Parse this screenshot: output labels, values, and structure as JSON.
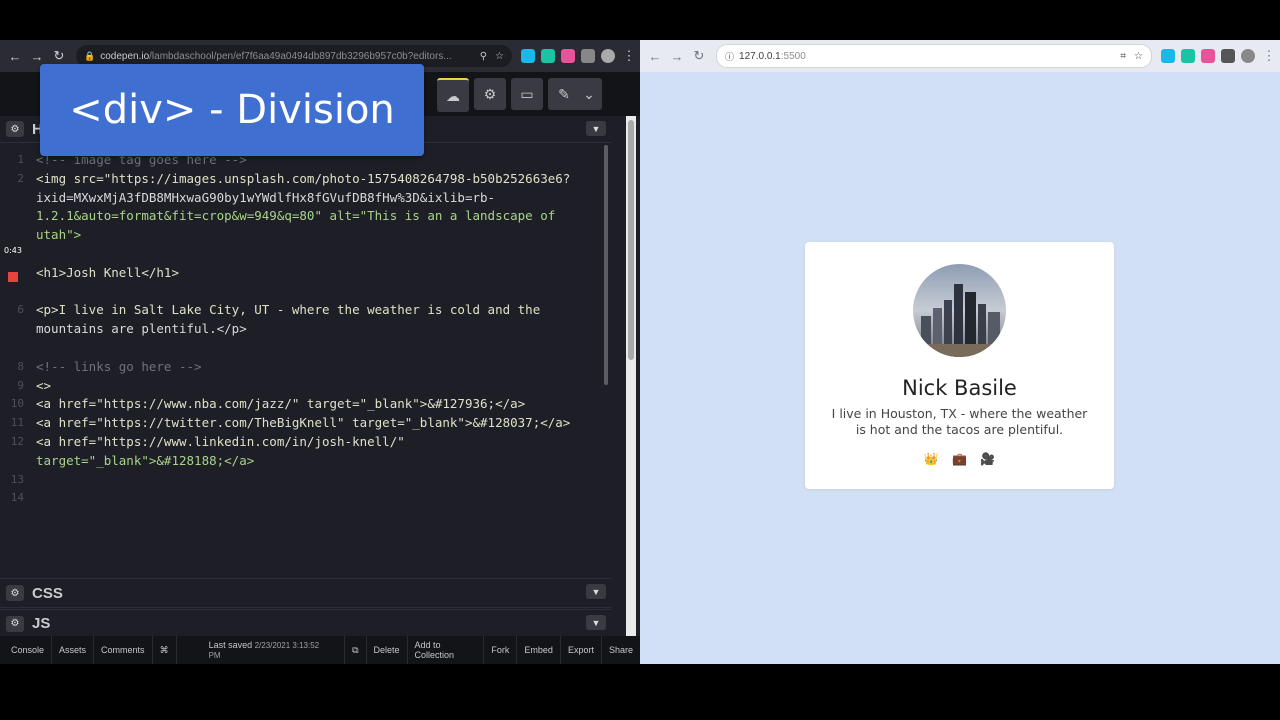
{
  "left_browser": {
    "url_domain": "codepen.io",
    "url_path": "/lambdaschool/pen/ef7f6aa49a0494db897db3296b957c0b?editors..."
  },
  "overlay": {
    "title": "<div> - Division"
  },
  "html_panel": {
    "title": "H"
  },
  "code_lines": [
    {
      "n": "1",
      "text": "<!-- image tag goes here -->"
    },
    {
      "n": "2",
      "text": "<img src=\"https://images.unsplash.com/photo-1575408264798-b50b252663e6?"
    },
    {
      "n": "",
      "text": "ixid=MXwxMjA3fDB8MHxwaG90by1wYWdlfHx8fGVufDB8fHw%3D&ixlib=rb-"
    },
    {
      "n": "",
      "text": "1.2.1&auto=format&fit=crop&w=949&q=80\" alt=\"This is an a landscape of"
    },
    {
      "n": "",
      "text": "utah\">"
    },
    {
      "n": "",
      "text": ""
    },
    {
      "n": "",
      "text": "<h1>Josh Knell</h1>"
    },
    {
      "n": "",
      "text": ""
    },
    {
      "n": "6",
      "text": "<p>I live in Salt Lake City, UT - where the weather is cold and the"
    },
    {
      "n": "",
      "text": "mountains are plentiful.</p>"
    },
    {
      "n": "",
      "text": ""
    },
    {
      "n": "8",
      "text": "<!-- links go here -->"
    },
    {
      "n": "9",
      "text": "<>"
    },
    {
      "n": "10",
      "text": "<a href=\"https://www.nba.com/jazz/\" target=\"_blank\">&#127936;</a>"
    },
    {
      "n": "11",
      "text": "<a href=\"https://twitter.com/TheBigKnell\" target=\"_blank\">&#128037;</a>"
    },
    {
      "n": "12",
      "text": "<a href=\"https://www.linkedin.com/in/josh-knell/\""
    },
    {
      "n": "",
      "text": "target=\"_blank\">&#128188;</a>"
    },
    {
      "n": "13",
      "text": ""
    },
    {
      "n": "14",
      "text": ""
    }
  ],
  "timecode": "0:43",
  "css_panel": {
    "title": "CSS"
  },
  "js_panel": {
    "title": "JS"
  },
  "footer": {
    "console": "Console",
    "assets": "Assets",
    "comments": "Comments",
    "shortcut": "⌘",
    "last_saved_label": "Last saved",
    "last_saved_time": "2/23/2021 3:13:52 PM",
    "delete": "Delete",
    "add_to_collection": "Add to Collection",
    "fork": "Fork",
    "embed": "Embed",
    "export": "Export",
    "share": "Share"
  },
  "right_browser": {
    "url_host": "127.0.0.1",
    "url_port": ":5500"
  },
  "card": {
    "name": "Nick Basile",
    "bio": "I live in Houston, TX - where the weather is hot and the tacos are plentiful.",
    "links": [
      "👑",
      "💼",
      "🎥"
    ]
  }
}
